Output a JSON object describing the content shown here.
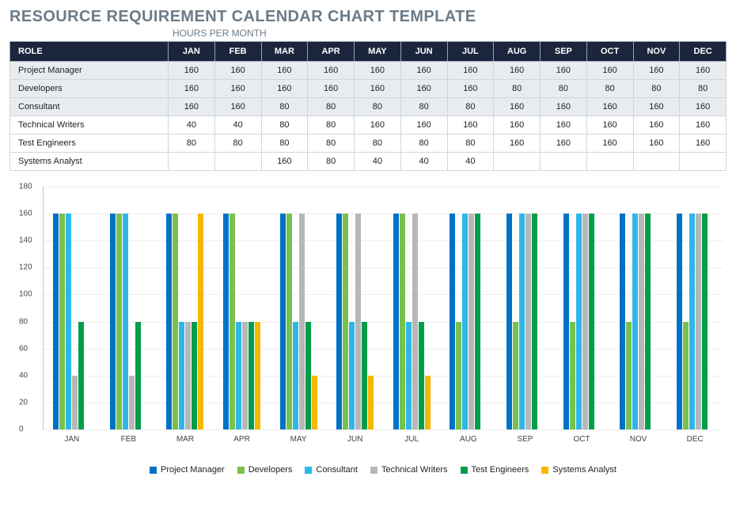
{
  "title": "RESOURCE REQUIREMENT CALENDAR CHART TEMPLATE",
  "subtitle": "HOURS PER MONTH",
  "table": {
    "role_header": "ROLE",
    "months": [
      "JAN",
      "FEB",
      "MAR",
      "APR",
      "MAY",
      "JUN",
      "JUL",
      "AUG",
      "SEP",
      "OCT",
      "NOV",
      "DEC"
    ],
    "rows": [
      {
        "role": "Project Manager",
        "vals": [
          "160",
          "160",
          "160",
          "160",
          "160",
          "160",
          "160",
          "160",
          "160",
          "160",
          "160",
          "160"
        ]
      },
      {
        "role": "Developers",
        "vals": [
          "160",
          "160",
          "160",
          "160",
          "160",
          "160",
          "160",
          "80",
          "80",
          "80",
          "80",
          "80"
        ]
      },
      {
        "role": "Consultant",
        "vals": [
          "160",
          "160",
          "80",
          "80",
          "80",
          "80",
          "80",
          "160",
          "160",
          "160",
          "160",
          "160"
        ]
      },
      {
        "role": "Technical Writers",
        "vals": [
          "40",
          "40",
          "80",
          "80",
          "160",
          "160",
          "160",
          "160",
          "160",
          "160",
          "160",
          "160"
        ]
      },
      {
        "role": "Test Engineers",
        "vals": [
          "80",
          "80",
          "80",
          "80",
          "80",
          "80",
          "80",
          "160",
          "160",
          "160",
          "160",
          "160"
        ]
      },
      {
        "role": "Systems Analyst",
        "vals": [
          "",
          "",
          "160",
          "80",
          "40",
          "40",
          "40",
          "",
          "",
          "",
          "",
          ""
        ]
      }
    ]
  },
  "chart_data": {
    "type": "bar",
    "title": "",
    "xlabel": "",
    "ylabel": "",
    "ylim": [
      0,
      180
    ],
    "yticks": [
      0,
      20,
      40,
      60,
      80,
      100,
      120,
      140,
      160,
      180
    ],
    "categories": [
      "JAN",
      "FEB",
      "MAR",
      "APR",
      "MAY",
      "JUN",
      "JUL",
      "AUG",
      "SEP",
      "OCT",
      "NOV",
      "DEC"
    ],
    "series": [
      {
        "name": "Project Manager",
        "color": "#0072c6",
        "values": [
          160,
          160,
          160,
          160,
          160,
          160,
          160,
          160,
          160,
          160,
          160,
          160
        ]
      },
      {
        "name": "Developers",
        "color": "#78c14d",
        "values": [
          160,
          160,
          160,
          160,
          160,
          160,
          160,
          80,
          80,
          80,
          80,
          80
        ]
      },
      {
        "name": "Consultant",
        "color": "#2fb6e8",
        "values": [
          160,
          160,
          80,
          80,
          80,
          80,
          80,
          160,
          160,
          160,
          160,
          160
        ]
      },
      {
        "name": "Technical Writers",
        "color": "#b7b7b7",
        "values": [
          40,
          40,
          80,
          80,
          160,
          160,
          160,
          160,
          160,
          160,
          160,
          160
        ]
      },
      {
        "name": "Test Engineers",
        "color": "#009e49",
        "values": [
          80,
          80,
          80,
          80,
          80,
          80,
          80,
          160,
          160,
          160,
          160,
          160
        ]
      },
      {
        "name": "Systems Analyst",
        "color": "#f5b800",
        "values": [
          null,
          null,
          160,
          80,
          40,
          40,
          40,
          null,
          null,
          null,
          null,
          null
        ]
      }
    ]
  }
}
